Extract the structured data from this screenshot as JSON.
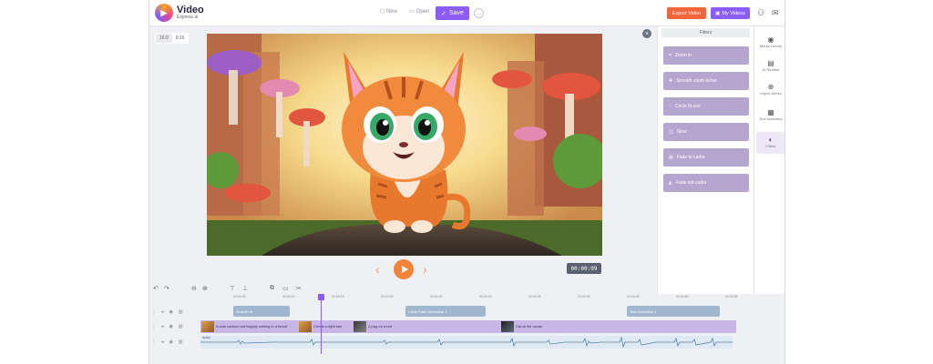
{
  "brand": {
    "name": "Video",
    "sub": "Express.ai"
  },
  "topbar": {
    "new_label": "New",
    "open_label": "Open",
    "save_label": "Save",
    "more_label": "...",
    "export_label": "Export Video",
    "myvideos_label": "My Videos"
  },
  "aspect": {
    "options": [
      "16:9",
      "9:16"
    ],
    "selected": "16:9"
  },
  "player": {
    "timecode": "00:00:09"
  },
  "filters_panel": {
    "title": "Filters",
    "items": [
      "Zoom in",
      "Smooth zoom in/out",
      "Circle fit one",
      "Slow",
      "Fade to cadre",
      "Fade out cadre"
    ]
  },
  "sidebar": {
    "items": [
      {
        "label": "Media Library",
        "icon": "camera-icon"
      },
      {
        "label": "AI Related",
        "icon": "briefcase-icon"
      },
      {
        "label": "Import Media",
        "icon": "import-icon"
      },
      {
        "label": "Text Animation",
        "icon": "film-icon"
      },
      {
        "label": "Filters",
        "icon": "filter-icon"
      }
    ],
    "active": "Filters"
  },
  "timeline": {
    "ticks": [
      "00:00:05",
      "00:00:10",
      "00:00:15",
      "00:00:20",
      "00:00:25",
      "00:00:30",
      "00:00:35",
      "00:00:40",
      "00:00:45",
      "00:00:50",
      "00:00:55"
    ],
    "filter_clips": [
      "Smooth fit",
      "Circle Fade Animation 1",
      "Text Animation 1"
    ],
    "video_clips": [
      "A cute cartoon cat happily smiling in a forest",
      "Create a light tale",
      "A pug on a hat",
      "Cat at the ocean"
    ],
    "audio_label": "Audio"
  },
  "colors": {
    "accent": "#8b5cf6",
    "export": "#f2643a",
    "play": "#f2843a",
    "filter_button": "#b5a6cf"
  }
}
